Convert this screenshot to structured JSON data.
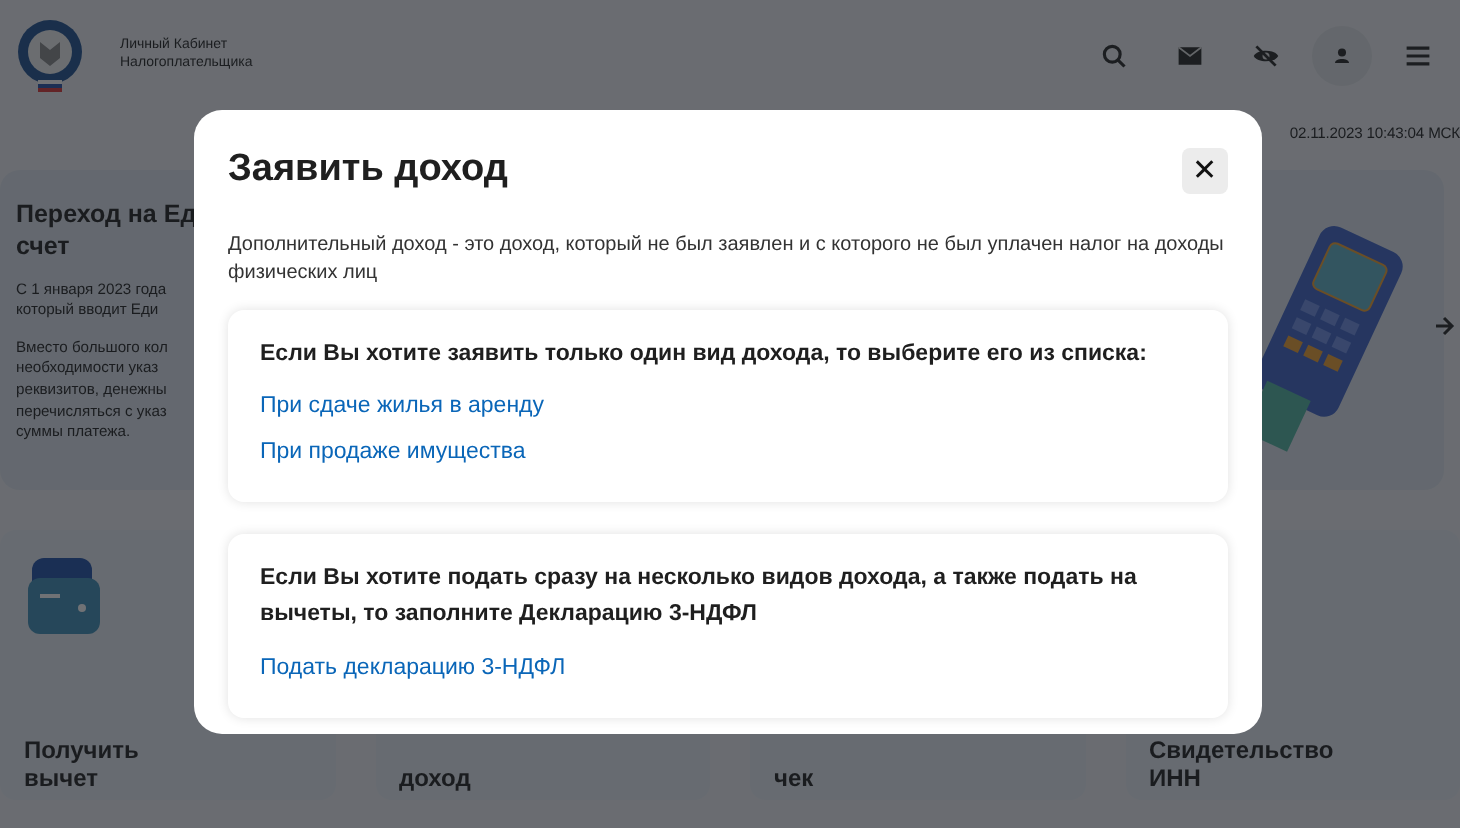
{
  "header": {
    "logo_text": "Личный Кабинет Налогоплательщика"
  },
  "datetime": "02.11.2023 10:43:04 МСК",
  "banner": {
    "title_lines": [
      "Переход на Ед",
      "счет"
    ],
    "text_lines": [
      "С 1 января 2023 года",
      "который вводит Еди"
    ],
    "text2_lines": [
      "Вместо большого кол",
      "необходимости указ",
      "реквизитов, денежны",
      "перечисляться с указ",
      "суммы платежа."
    ]
  },
  "tiles": [
    {
      "title": "Получить вычет",
      "kind": "wallet"
    },
    {
      "title": "доход",
      "kind": "plain"
    },
    {
      "title": "чек",
      "kind": "plain"
    },
    {
      "title": "Свидетельство ИНН",
      "kind": "plain"
    }
  ],
  "modal": {
    "title": "Заявить доход",
    "close": "✕",
    "description": "Дополнительный доход - это доход, который не был заявлен и с которого не был уплачен налог на доходы физических лиц",
    "sections": [
      {
        "heading": "Если Вы хотите заявить только один вид дохода, то выберите его из списка:",
        "links": [
          "При сдаче жилья в аренду",
          "При продаже имущества"
        ]
      },
      {
        "heading": "Если Вы хотите подать сразу на несколько видов дохода, а также подать на вычеты, то заполните Декларацию 3-НДФЛ",
        "links": [
          "Подать декларацию 3-НДФЛ"
        ]
      }
    ]
  }
}
